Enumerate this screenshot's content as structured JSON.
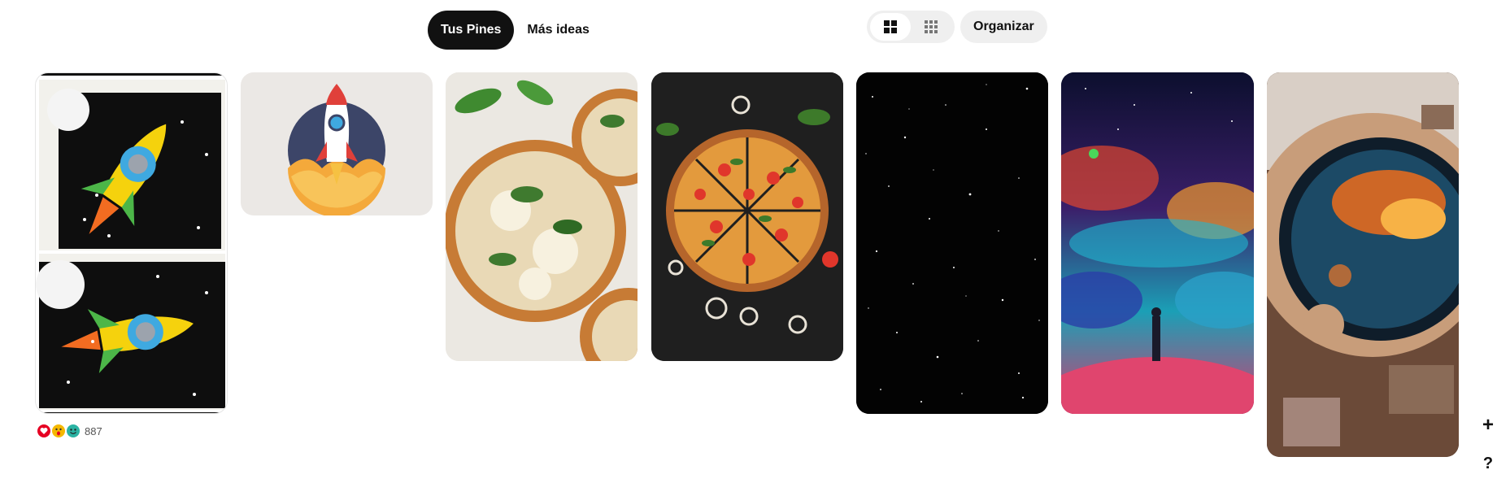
{
  "tabs": [
    {
      "label": "Tus Pines",
      "active": true
    },
    {
      "label": "Más ideas",
      "active": false
    }
  ],
  "view_toggle": {
    "default_icon": "grid-2x2-icon",
    "compact_icon": "grid-3x3-icon",
    "selected": "default"
  },
  "organize_label": "Organizar",
  "pins": [
    {
      "name": "pin-rocket-craft",
      "description_icon": "rocket-craft-image"
    },
    {
      "name": "pin-rocket-logo",
      "description_icon": "rocket-logo-image"
    },
    {
      "name": "pin-margherita-pizza",
      "description_icon": "pizza-image"
    },
    {
      "name": "pin-pizza-slices",
      "description_icon": "pizza-image"
    },
    {
      "name": "pin-starfield",
      "description_icon": "stars-image"
    },
    {
      "name": "pin-space-painting",
      "description_icon": "galaxy-image"
    },
    {
      "name": "pin-astronaut-helmet",
      "description_icon": "astronaut-image"
    }
  ],
  "reactions": {
    "icons": [
      "heart-icon",
      "wow-face-icon",
      "smile-face-icon"
    ],
    "count": "887"
  },
  "floating": {
    "add_label": "+",
    "help_label": "?"
  },
  "colors": {
    "active_tab_bg": "#111111",
    "toggle_bg": "#efefef",
    "heart": "#e60023"
  }
}
